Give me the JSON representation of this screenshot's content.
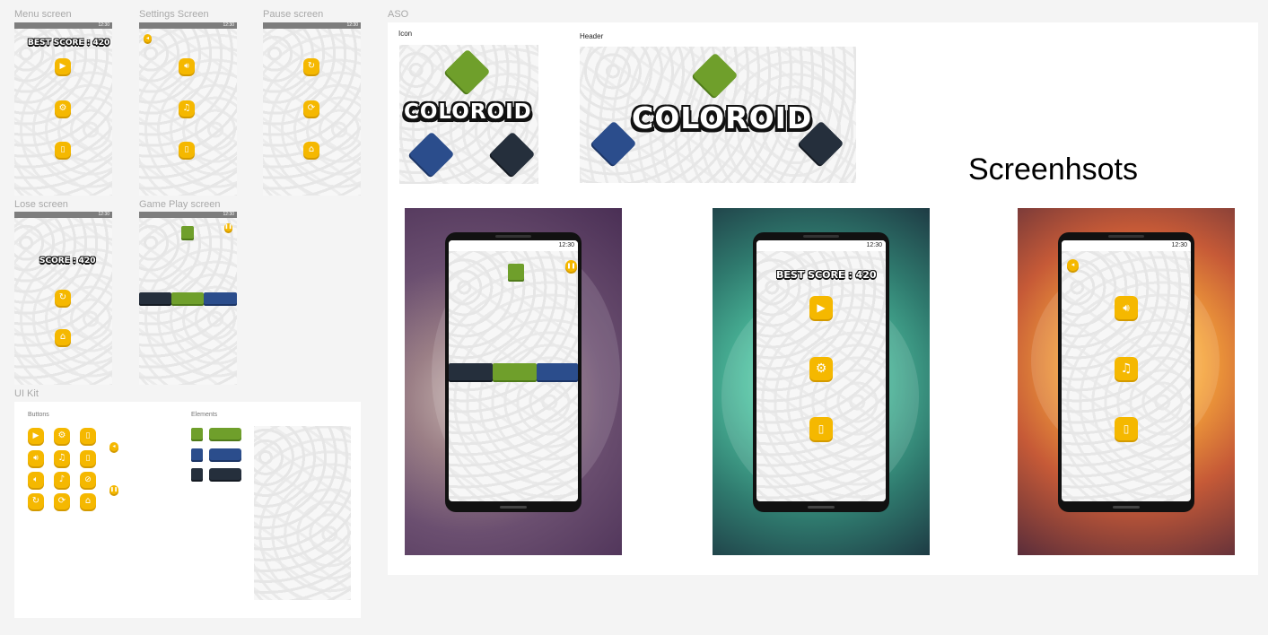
{
  "frames": {
    "menu": {
      "label": "Menu screen",
      "time": "12:30",
      "best_score": "BEST SCORE : 420"
    },
    "settings": {
      "label": "Settings Screen",
      "time": "12:30"
    },
    "pause": {
      "label": "Pause screen",
      "time": "12:30"
    },
    "lose": {
      "label": "Lose screen",
      "time": "12:30",
      "score": "SCORE : 420"
    },
    "gameplay": {
      "label": "Game Play screen",
      "time": "12:30"
    },
    "uikit": {
      "label": "UI Kit",
      "buttons_label": "Buttons",
      "elements_label": "Elements"
    },
    "aso": {
      "label": "ASO",
      "icon_label": "Icon",
      "header_label": "Header",
      "logo": "COLOROID",
      "screenshots_title": "Screenhsots"
    }
  },
  "phones": [
    {
      "time": "12:30"
    },
    {
      "time": "12:30",
      "best_score": "BEST SCORE : 420"
    },
    {
      "time": "12:30"
    }
  ],
  "colors": {
    "accent_yellow": "#f5b800",
    "tile_green": "#6f9f2b",
    "tile_blue": "#2b4d8c",
    "tile_navy": "#252f3c"
  },
  "icons": {
    "play": "play-icon",
    "settings": "gear-icon",
    "exit": "door-icon",
    "sound": "speaker-icon",
    "music": "music-note-icon",
    "vibration": "vibrate-icon",
    "restart": "restart-icon",
    "replay": "replay-icon",
    "home": "home-icon",
    "back": "back-icon",
    "pause": "pause-icon"
  }
}
